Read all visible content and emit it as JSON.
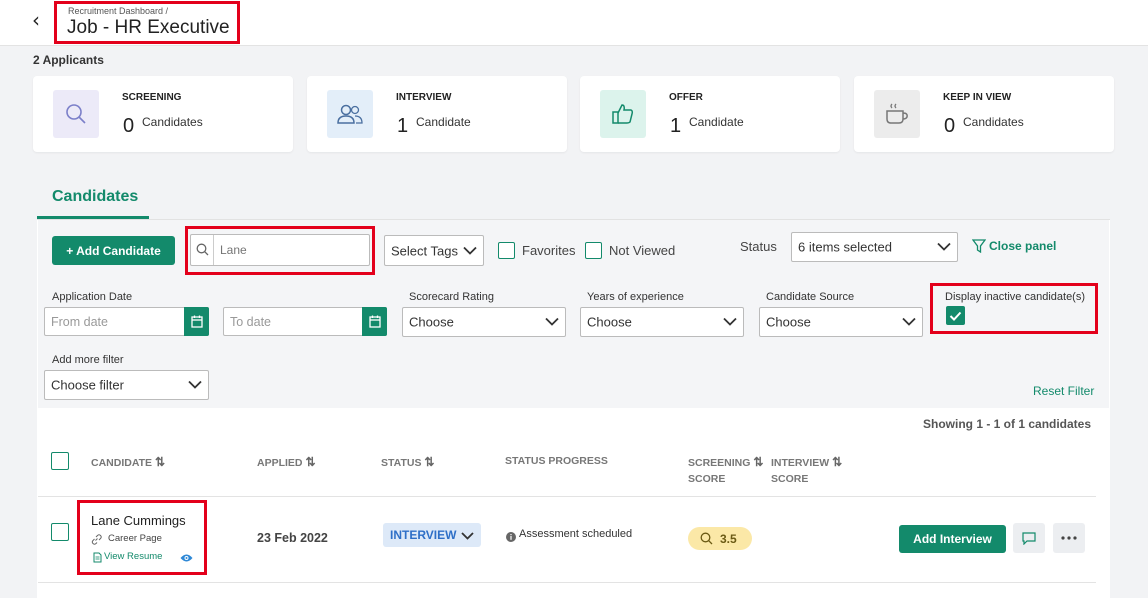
{
  "header": {
    "breadcrumb": "Recruitment Dashboard /",
    "title": "Job - HR Executive"
  },
  "applicants_count": "2 Applicants",
  "stage_cards": [
    {
      "label": "SCREENING",
      "count": "0",
      "unit": "Candidates",
      "icon": "search-icon",
      "icon_bg": "#eceaf8",
      "icon_color": "#7b7fc9"
    },
    {
      "label": "INTERVIEW",
      "count": "1",
      "unit": "Candidate",
      "icon": "users-icon",
      "icon_bg": "#e3eef9",
      "icon_color": "#4a6fa0"
    },
    {
      "label": "OFFER",
      "count": "1",
      "unit": "Candidate",
      "icon": "thumbs-up-icon",
      "icon_bg": "#dcf3ec",
      "icon_color": "#138a6b"
    },
    {
      "label": "KEEP IN VIEW",
      "count": "0",
      "unit": "Candidates",
      "icon": "coffee-cup-icon",
      "icon_bg": "#ececec",
      "icon_color": "#777777"
    }
  ],
  "tabs": {
    "candidates": "Candidates"
  },
  "toolbar": {
    "add_candidate": "+ Add Candidate",
    "search_placeholder": "Lane",
    "select_tags": "Select Tags",
    "favorites": "Favorites",
    "not_viewed": "Not Viewed",
    "status_label": "Status",
    "status_value": "6 items selected",
    "close_panel": "Close panel"
  },
  "filters": {
    "application_date": "Application Date",
    "from_date": "From date",
    "to_date": "To date",
    "scorecard_rating": "Scorecard Rating",
    "scorecard_value": "Choose",
    "years_experience": "Years of experience",
    "years_value": "Choose",
    "candidate_source": "Candidate Source",
    "source_value": "Choose",
    "display_inactive": "Display inactive candidate(s)",
    "display_inactive_checked": true,
    "add_more_filter": "Add more filter",
    "choose_filter": "Choose filter",
    "reset_filter": "Reset Filter"
  },
  "results": {
    "showing": "Showing 1 - 1 of 1 candidates"
  },
  "table": {
    "headers": {
      "candidate": "CANDIDATE",
      "applied": "APPLIED",
      "status": "STATUS",
      "status_progress": "STATUS PROGRESS",
      "screening": "SCREENING",
      "screening_score": "SCORE",
      "interview": "INTERVIEW",
      "interview_score": "SCORE"
    },
    "rows": [
      {
        "name": "Lane Cummings",
        "source": "Career Page",
        "view_resume": "View Resume",
        "applied": "23 Feb 2022",
        "status": "INTERVIEW",
        "progress": "Assessment scheduled",
        "screening_score": "3.5",
        "action": "Add Interview"
      }
    ]
  },
  "colors": {
    "accent": "#138a6b",
    "highlight": "#e3001b",
    "status_blue": "#2e6fc7",
    "score_yellow": "#fbe8a7"
  }
}
